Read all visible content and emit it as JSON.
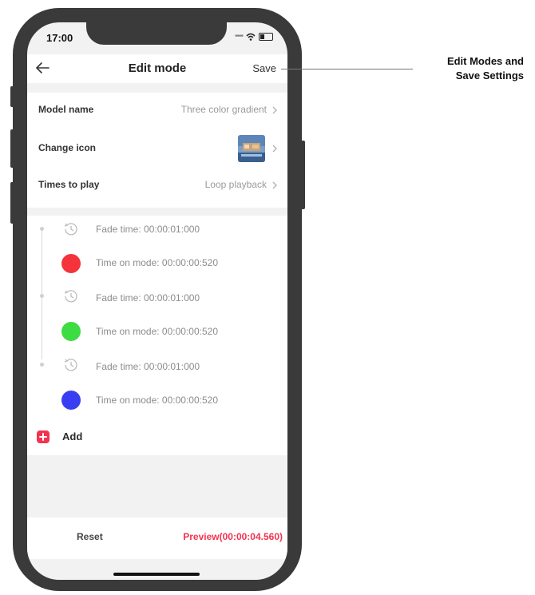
{
  "status_bar": {
    "time": "17:00"
  },
  "nav": {
    "title": "Edit mode",
    "save_label": "Save"
  },
  "settings": {
    "model_name": {
      "label": "Model name",
      "value": "Three color gradient"
    },
    "change_icon": {
      "label": "Change icon"
    },
    "times_to_play": {
      "label": "Times to play",
      "value": "Loop playback"
    }
  },
  "steps": [
    {
      "fade_text": "Fade time: 00:00:01:000",
      "color": "#f5333b",
      "color_name": "red",
      "time_text": "Time on mode: 00:00:00:520"
    },
    {
      "fade_text": "Fade time: 00:00:01:000",
      "color": "#3ddc42",
      "color_name": "green",
      "time_text": "Time on mode: 00:00:00:520"
    },
    {
      "fade_text": "Fade time: 00:00:01:000",
      "color": "#3a3ef2",
      "color_name": "blue",
      "time_text": "Time on mode: 00:00:00:520"
    }
  ],
  "add_label": "Add",
  "footer": {
    "reset_label": "Reset",
    "preview_label": "Preview(00:00:04.560)"
  },
  "callout": {
    "line1": "Edit Modes and",
    "line2": "Save Settings"
  },
  "colors": {
    "accent": "#f2334f",
    "background": "#f2f2f2"
  }
}
